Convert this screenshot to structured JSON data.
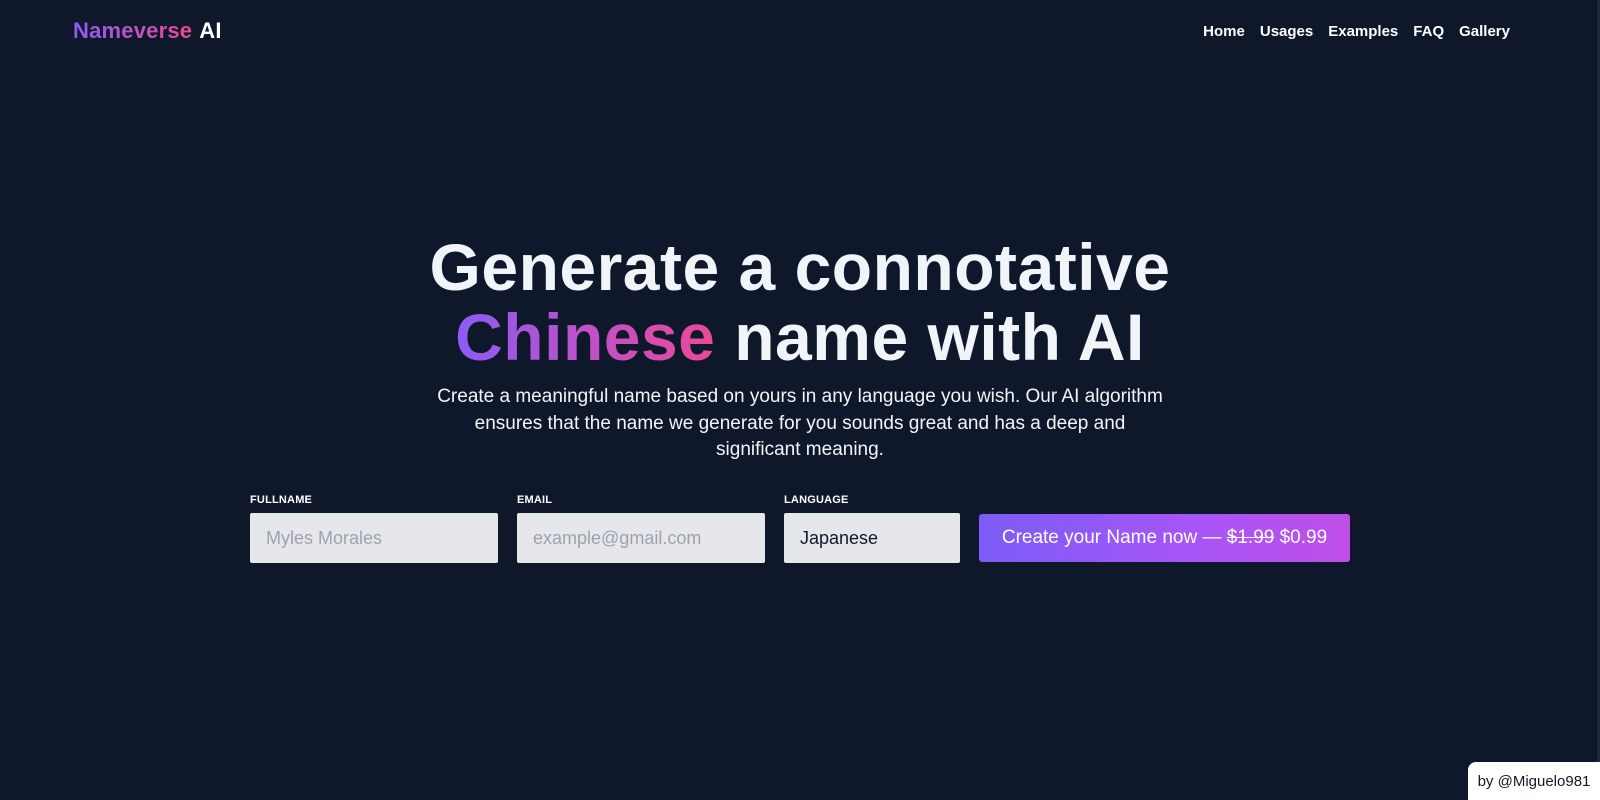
{
  "header": {
    "logo_part1": "Nameverse",
    "logo_part2": "AI",
    "nav": [
      "Home",
      "Usages",
      "Examples",
      "FAQ",
      "Gallery"
    ]
  },
  "hero": {
    "line1": "Generate a connotative",
    "highlight": "Chinese",
    "line2_rest": "name with AI",
    "subtitle": "Create a meaningful name based on yours in any language you wish. Our AI algorithm ensures that the name we generate for you sounds great and has a deep and significant meaning."
  },
  "form": {
    "fullname_label": "FULLNAME",
    "fullname_placeholder": "Myles Morales",
    "email_label": "EMAIL",
    "email_placeholder": "example@gmail.com",
    "language_label": "LANGUAGE",
    "language_value": "Japanese",
    "cta_prefix": "Create your Name now —",
    "cta_old_price": "$1.99",
    "cta_new_price": "$0.99"
  },
  "credit": "by @Miguelo981",
  "colors": {
    "background": "#0f172a",
    "gradient_start": "#8b5cf6",
    "gradient_end": "#ec4899",
    "input_bg": "#e5e7eb"
  }
}
